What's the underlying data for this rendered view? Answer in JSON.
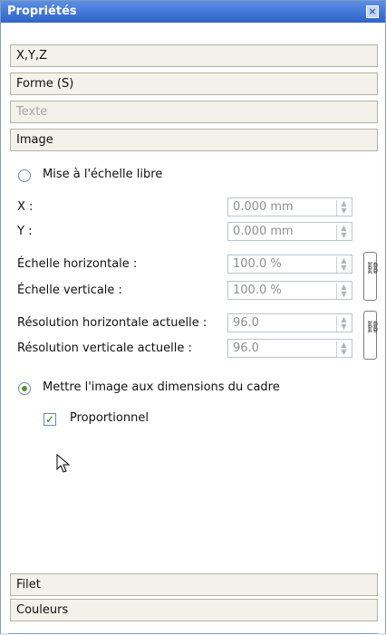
{
  "window": {
    "title": "Propriétés",
    "close_label": "×"
  },
  "sections": {
    "xyz": "X,Y,Z",
    "shape": "Forme (S)",
    "text": "Texte",
    "image": "Image",
    "line": "Filet",
    "colors": "Couleurs"
  },
  "scaling": {
    "free_scale": "Mise à l'échelle libre",
    "x_label": "X :",
    "x_value": "0.000 mm",
    "y_label": "Y :",
    "y_value": "0.000 mm",
    "h_scale_label": "Échelle horizontale :",
    "h_scale_value": "100.0 %",
    "v_scale_label": "Échelle verticale :",
    "v_scale_value": "100.0 %",
    "h_res_label": "Résolution horizontale actuelle :",
    "h_res_value": "96.0",
    "v_res_label": "Résolution verticale actuelle :",
    "v_res_value": "96.0",
    "fit_frame": "Mettre l'image aux dimensions du cadre",
    "proportional": "Proportionnel"
  }
}
